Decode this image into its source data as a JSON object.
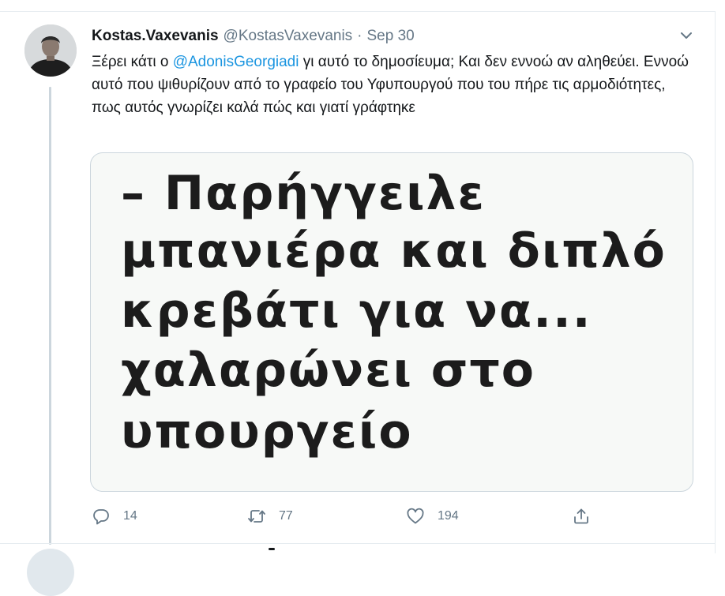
{
  "tweet": {
    "display_name": "Kostas.Vaxevanis",
    "handle": "@KostasVaxevanis",
    "separator": "·",
    "date": "Sep 30",
    "text_before_mention": "Ξέρει κάτι ο ",
    "mention": "@AdonisGeorgiadi",
    "text_after_mention": " γι αυτό το δημοσίευμα; Και δεν εννοώ αν αληθεύει. Εννοώ αυτό που ψιθυρίζουν από το γραφείο του Υφυπουργού που του πήρε τις αρμοδιότητες, πως αυτός γνωρίζει καλά πώς και γιατί γράφτηκε",
    "media_lines": [
      "– Παρήγγειλε",
      "μπανιέρα και διπλό",
      "κρεβάτι για να...",
      "χαλαρώνει στο",
      "υπουργείο"
    ],
    "actions": {
      "reply_icon": "reply-icon",
      "reply_count": "14",
      "retweet_icon": "retweet-icon",
      "retweet_count": "77",
      "like_icon": "heart-icon",
      "like_count": "194",
      "share_icon": "share-icon"
    },
    "menu_icon": "chevron-down-icon"
  },
  "colors": {
    "text": "#14171a",
    "secondary": "#657786",
    "link": "#1b95e0",
    "border": "#e6ecf0"
  }
}
